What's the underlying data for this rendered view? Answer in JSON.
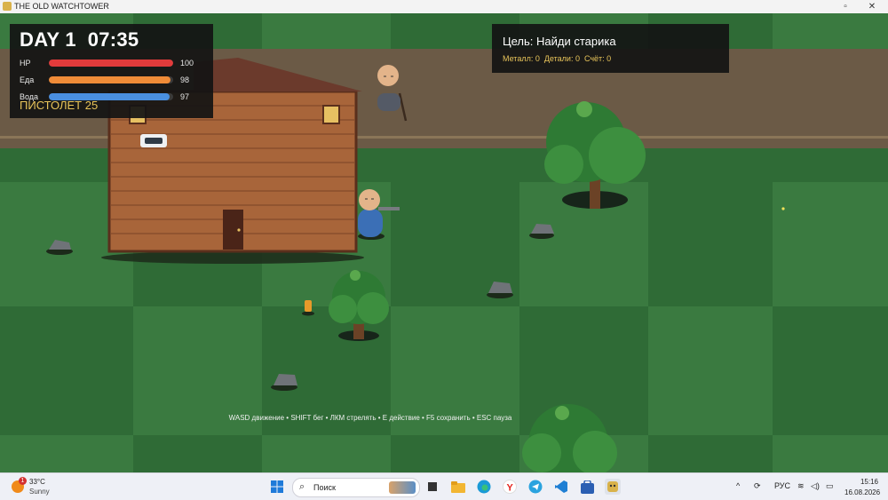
{
  "window": {
    "title": "THE OLD WATCHTOWER",
    "minimize_glyph": "▫",
    "close_glyph": "✕"
  },
  "hud": {
    "day_time": "DAY 1  07:35",
    "stats": [
      {
        "label": "HP",
        "value": "100",
        "fraction": 1.0,
        "color": "#e23b3b"
      },
      {
        "label": "Еда",
        "value": "98",
        "fraction": 0.98,
        "color": "#f08c38"
      },
      {
        "label": "Вода",
        "value": "97",
        "fraction": 0.97,
        "color": "#4a8fe0"
      }
    ],
    "weapon": "ПИСТОЛЕТ 25"
  },
  "objective": {
    "title": "Цель: Найди старика",
    "resources": "Металл: 0  Детали: 0  Счёт: 0"
  },
  "controls_hint": "WASD движение • SHIFT бег • ЛКМ стрелять • E действие • F5 сохранить • ESC пауза",
  "colors": {
    "grass_dark": "#2e6a35",
    "grass_light": "#3a7a40",
    "road": "#6b5a46",
    "house_wall": "#a8653a",
    "roof": "#6b3a2c",
    "hp": "#e23b3b",
    "food": "#f08c38",
    "water": "#4a8fe0",
    "accent_yellow": "#e8c45a"
  },
  "taskbar": {
    "weather_temp": "33°C",
    "weather_desc": "Sunny",
    "weather_badge": "1",
    "search_placeholder": "Поиск",
    "apps": [
      "windows-start-icon",
      "task-view-icon",
      "file-explorer-icon",
      "edge-browser-icon",
      "yandex-browser-icon",
      "telegram-icon",
      "vscode-icon",
      "store-icon",
      "game-app-icon"
    ],
    "tray_chevron": "^",
    "language": "РУС",
    "time": "15:16",
    "date": "16.08.2026"
  }
}
